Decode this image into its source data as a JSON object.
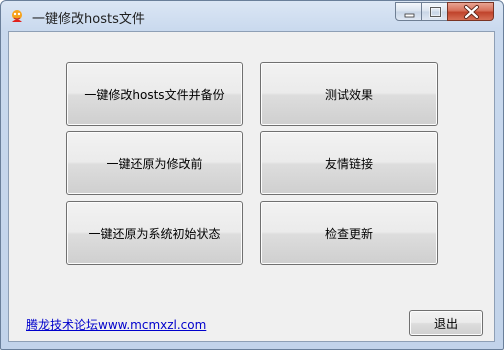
{
  "window": {
    "title": "一键修改hosts文件"
  },
  "buttons": {
    "modify_backup": "一键修改hosts文件并备份",
    "test_effect": "测试效果",
    "restore_before": "一键还原为修改前",
    "friend_links": "友情链接",
    "restore_initial": "一键还原为系统初始状态",
    "check_update": "检查更新",
    "exit": "退出"
  },
  "footer": {
    "link_text": "腾龙技术论坛www.mcmxzl.com"
  },
  "colors": {
    "link": "#0000cc",
    "close_button": "#c0432b"
  },
  "icons": [
    "app-icon",
    "minimize-icon",
    "maximize-icon",
    "close-icon"
  ]
}
